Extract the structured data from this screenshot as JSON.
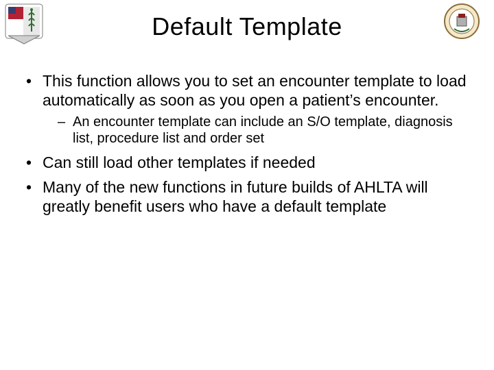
{
  "title": "Default Template",
  "bullets": {
    "b1": "This function allows you to set an encounter template to load automatically as soon as you open a patient’s encounter.",
    "b1_sub1": "An encounter template can include an S/O template, diagnosis list, procedure list and order set",
    "b2": "Can still load other templates if needed",
    "b3": "Many of the new functions in future builds of AHLTA will greatly benefit users who have a default template"
  },
  "logos": {
    "left_alt": "medical-unit-shield",
    "right_alt": "command-seal"
  }
}
